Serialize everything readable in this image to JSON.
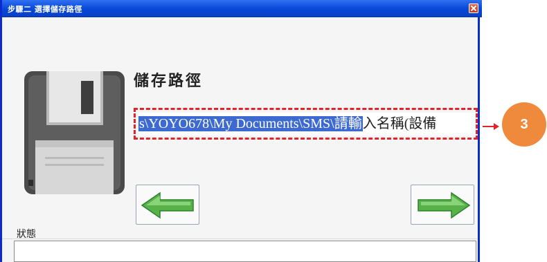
{
  "window": {
    "title": "步驟二 選擇儲存路徑"
  },
  "main": {
    "heading": "儲存路徑",
    "path_selected": "s\\YOYO678\\My Documents\\SMS\\請輸",
    "path_rest": "入名稱(設備",
    "back_button": "back",
    "next_button": "next"
  },
  "status": {
    "label": "狀態",
    "value": ""
  },
  "annotation": {
    "number": "3",
    "box_color": "#e0252a",
    "badge_color": "#ef8a3c"
  }
}
